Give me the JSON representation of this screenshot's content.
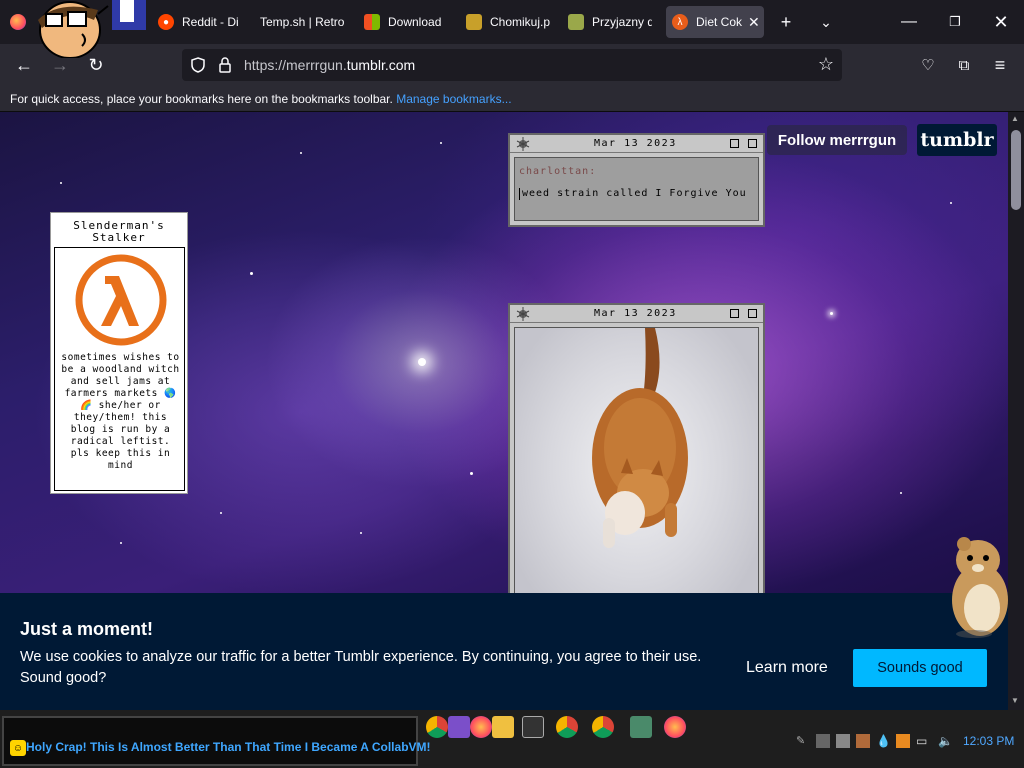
{
  "browser": {
    "tabs": [
      {
        "label": "Reddit - Di",
        "icon": "reddit-icon",
        "color": "#ff4500"
      },
      {
        "label": "Temp.sh | Retro",
        "icon": "tempsh-icon",
        "color": "#2b2a33"
      },
      {
        "label": "Download",
        "icon": "windows-icon",
        "color": "#f25022"
      },
      {
        "label": "Chomikuj.p",
        "icon": "chomikuj-icon",
        "color": "#c8a02a"
      },
      {
        "label": "Przyjazny d",
        "icon": "przyjazny-icon",
        "color": "#9aa84a"
      },
      {
        "label": "Diet Cok",
        "icon": "halflife-icon",
        "color": "#e85d1a"
      }
    ],
    "url_prefix": "https://merrrgun.",
    "url_domain": "tumblr.com",
    "bookmarks_msg": "For quick access, place your bookmarks here on the bookmarks toolbar.",
    "bookmarks_link": "Manage bookmarks..."
  },
  "blog": {
    "title": "Slenderman's Stalker",
    "description": "sometimes wishes to be a woodland witch and sell jams at farmers markets 🌎🌈 she/her or they/them! this blog is run by a radical leftist. pls keep this in mind",
    "follow_label": "Follow merrrgun",
    "logo": "tumblr"
  },
  "posts": [
    {
      "date": "Mar 13 2023",
      "username": "charlottan:",
      "text": "weed strain called I Forgive You"
    },
    {
      "date": "Mar 13 2023"
    }
  ],
  "cookie": {
    "title": "Just a moment!",
    "message": "We use cookies to analyze our traffic for a better Tumblr experience. By continuing, you agree to their use. Sound good?",
    "learn_more": "Learn more",
    "accept": "Sounds good"
  },
  "taskbar": {
    "ticker": "Holy Crap! This Is Almost Better Than That Time I Became A CollabVM!",
    "clock": "12:03 PM"
  }
}
